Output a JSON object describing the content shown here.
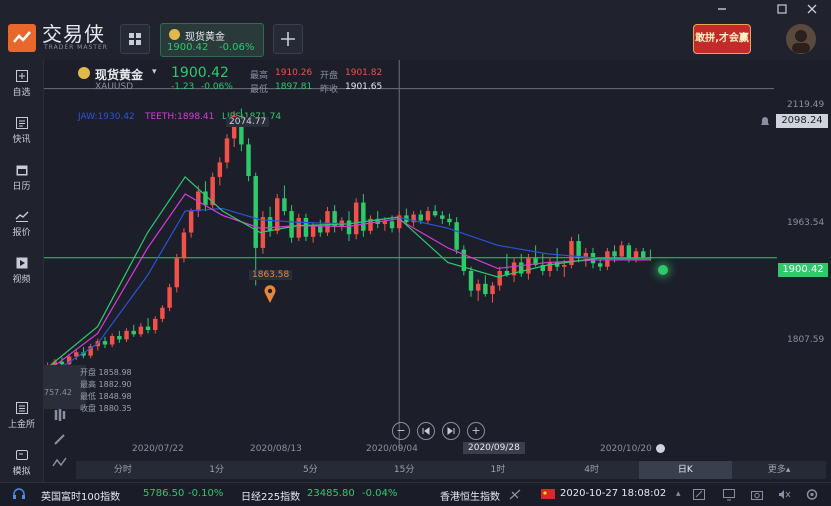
{
  "app": {
    "brand": "交易侠",
    "brand_sub": "TRADER MASTER",
    "promo": "敢拼,才会赢"
  },
  "tab": {
    "name": "现货黄金",
    "price": "1900.42",
    "change_pct": "-0.06%"
  },
  "window_controls": [
    "minimize-icon",
    "maximize-icon",
    "close-icon"
  ],
  "sidebar": {
    "top": [
      {
        "label": "自选",
        "icon": "watchlist-icon"
      },
      {
        "label": "快讯",
        "icon": "news-icon"
      },
      {
        "label": "日历",
        "icon": "calendar-icon"
      },
      {
        "label": "报价",
        "icon": "quote-icon"
      },
      {
        "label": "视频",
        "icon": "video-icon"
      }
    ],
    "bottom": [
      {
        "label": "上金所",
        "icon": "exchange-icon"
      },
      {
        "label": "模拟",
        "icon": "simulate-icon"
      }
    ]
  },
  "quote": {
    "name": "现货黄金",
    "code": "XAUUSD",
    "price": "1900.42",
    "change": "-1.23",
    "change_pct": "-0.06%",
    "high_label": "最高",
    "high": "1910.26",
    "open_label": "开盘",
    "open": "1901.82",
    "low_label": "最低",
    "low": "1897.81",
    "prev_label": "昨收",
    "prev": "1901.65"
  },
  "indicators": {
    "jaw": "JAW:1930.42",
    "teeth": "TEETH:1898.41",
    "lips": "LIPS:1871.74"
  },
  "ohlc_box": {
    "open": "开盘 1858.98",
    "high": "最高 1882.90",
    "low": "最低 1848.98",
    "close": "收盘 1880.35"
  },
  "colors": {
    "up": "#f0524a",
    "down": "#2fc86b",
    "jaw": "#2c52d6",
    "teeth": "#d63cd6",
    "lips": "#2fc86b",
    "current": "#2fc86b"
  },
  "chart_data": {
    "type": "candlestick",
    "ylim": [
      1740,
      2120
    ],
    "y_ticks": [
      "2119.49",
      "1963.54",
      "1807.59"
    ],
    "x_ticks": [
      "2020/07/22",
      "2020/08/13",
      "2020/09/04",
      "2020/09/28",
      "2020/10/20"
    ],
    "crosshair": {
      "date": "2020/09/28",
      "price": "2098.24"
    },
    "last_price": "1900.42",
    "markers": {
      "high": "2074.77",
      "low": "1863.58",
      "left_value": "757.42"
    },
    "candles": [
      [
        1768,
        1778,
        1764,
        1774
      ],
      [
        1774,
        1782,
        1770,
        1779
      ],
      [
        1779,
        1784,
        1774,
        1776
      ],
      [
        1776,
        1788,
        1772,
        1785
      ],
      [
        1785,
        1794,
        1781,
        1790
      ],
      [
        1790,
        1796,
        1783,
        1786
      ],
      [
        1786,
        1800,
        1783,
        1797
      ],
      [
        1797,
        1806,
        1792,
        1803
      ],
      [
        1803,
        1808,
        1795,
        1799
      ],
      [
        1799,
        1812,
        1796,
        1809
      ],
      [
        1809,
        1815,
        1801,
        1805
      ],
      [
        1805,
        1818,
        1802,
        1815
      ],
      [
        1815,
        1822,
        1808,
        1811
      ],
      [
        1811,
        1824,
        1808,
        1820
      ],
      [
        1820,
        1830,
        1812,
        1816
      ],
      [
        1816,
        1832,
        1812,
        1829
      ],
      [
        1829,
        1845,
        1825,
        1842
      ],
      [
        1842,
        1870,
        1838,
        1866
      ],
      [
        1866,
        1905,
        1860,
        1900
      ],
      [
        1900,
        1935,
        1895,
        1930
      ],
      [
        1930,
        1958,
        1924,
        1955
      ],
      [
        1955,
        1985,
        1948,
        1978
      ],
      [
        1978,
        1990,
        1955,
        1962
      ],
      [
        1962,
        2000,
        1958,
        1995
      ],
      [
        1995,
        2018,
        1985,
        2012
      ],
      [
        2012,
        2045,
        2005,
        2040
      ],
      [
        2040,
        2072,
        2030,
        2066
      ],
      [
        2066,
        2075,
        2025,
        2033
      ],
      [
        2033,
        2040,
        1990,
        1996
      ],
      [
        1996,
        2000,
        1868,
        1912
      ],
      [
        1912,
        1955,
        1905,
        1948
      ],
      [
        1948,
        1960,
        1925,
        1932
      ],
      [
        1932,
        1975,
        1928,
        1970
      ],
      [
        1970,
        1985,
        1950,
        1955
      ],
      [
        1955,
        1962,
        1918,
        1924
      ],
      [
        1924,
        1952,
        1920,
        1947
      ],
      [
        1947,
        1952,
        1920,
        1925
      ],
      [
        1925,
        1942,
        1918,
        1938
      ],
      [
        1938,
        1945,
        1925,
        1930
      ],
      [
        1930,
        1960,
        1926,
        1955
      ],
      [
        1955,
        1962,
        1930,
        1937
      ],
      [
        1937,
        1948,
        1932,
        1944
      ],
      [
        1944,
        1955,
        1920,
        1928
      ],
      [
        1928,
        1970,
        1922,
        1965
      ],
      [
        1965,
        1975,
        1925,
        1932
      ],
      [
        1932,
        1950,
        1928,
        1946
      ],
      [
        1946,
        1955,
        1935,
        1940
      ],
      [
        1940,
        1948,
        1932,
        1943
      ],
      [
        1943,
        1950,
        1930,
        1935
      ],
      [
        1935,
        1955,
        1930,
        1950
      ],
      [
        1950,
        1958,
        1938,
        1942
      ],
      [
        1942,
        1955,
        1937,
        1951
      ],
      [
        1951,
        1956,
        1940,
        1944
      ],
      [
        1944,
        1960,
        1940,
        1955
      ],
      [
        1955,
        1962,
        1948,
        1950
      ],
      [
        1950,
        1955,
        1940,
        1946
      ],
      [
        1946,
        1952,
        1938,
        1942
      ],
      [
        1942,
        1948,
        1905,
        1910
      ],
      [
        1910,
        1915,
        1880,
        1885
      ],
      [
        1885,
        1890,
        1855,
        1862
      ],
      [
        1862,
        1875,
        1850,
        1870
      ],
      [
        1870,
        1880,
        1855,
        1858
      ],
      [
        1858,
        1872,
        1848,
        1868
      ],
      [
        1868,
        1890,
        1862,
        1885
      ],
      [
        1885,
        1905,
        1878,
        1880
      ],
      [
        1880,
        1900,
        1872,
        1895
      ],
      [
        1895,
        1905,
        1878,
        1882
      ],
      [
        1882,
        1905,
        1875,
        1900
      ],
      [
        1900,
        1915,
        1890,
        1892
      ],
      [
        1892,
        1905,
        1880,
        1885
      ],
      [
        1885,
        1900,
        1878,
        1895
      ],
      [
        1895,
        1912,
        1885,
        1890
      ],
      [
        1890,
        1898,
        1878,
        1892
      ],
      [
        1892,
        1925,
        1888,
        1920
      ],
      [
        1920,
        1928,
        1895,
        1900
      ],
      [
        1900,
        1912,
        1890,
        1906
      ],
      [
        1906,
        1912,
        1888,
        1894
      ],
      [
        1894,
        1900,
        1885,
        1890
      ],
      [
        1890,
        1912,
        1886,
        1908
      ],
      [
        1908,
        1915,
        1895,
        1902
      ],
      [
        1902,
        1920,
        1898,
        1915
      ],
      [
        1915,
        1918,
        1895,
        1900
      ],
      [
        1900,
        1912,
        1895,
        1908
      ],
      [
        1908,
        1912,
        1898,
        1901
      ],
      [
        1901,
        1910,
        1897,
        1900
      ]
    ],
    "jaw": [
      [
        0,
        1762
      ],
      [
        20,
        1800
      ],
      [
        40,
        1880
      ],
      [
        55,
        1955
      ],
      [
        70,
        1958
      ],
      [
        85,
        1945
      ],
      [
        100,
        1942
      ],
      [
        120,
        1940
      ],
      [
        140,
        1948
      ],
      [
        160,
        1935
      ],
      [
        180,
        1915
      ],
      [
        200,
        1905
      ],
      [
        220,
        1900
      ],
      [
        241,
        1898
      ]
    ],
    "teeth": [
      [
        0,
        1768
      ],
      [
        20,
        1812
      ],
      [
        40,
        1912
      ],
      [
        55,
        1975
      ],
      [
        70,
        1950
      ],
      [
        85,
        1935
      ],
      [
        100,
        1938
      ],
      [
        120,
        1937
      ],
      [
        140,
        1946
      ],
      [
        160,
        1912
      ],
      [
        180,
        1888
      ],
      [
        200,
        1895
      ],
      [
        220,
        1898
      ],
      [
        241,
        1898
      ]
    ],
    "lips": [
      [
        0,
        1772
      ],
      [
        20,
        1820
      ],
      [
        40,
        1930
      ],
      [
        55,
        1995
      ],
      [
        70,
        1955
      ],
      [
        85,
        1930
      ],
      [
        100,
        1938
      ],
      [
        120,
        1940
      ],
      [
        140,
        1948
      ],
      [
        160,
        1895
      ],
      [
        180,
        1878
      ],
      [
        200,
        1892
      ],
      [
        220,
        1900
      ],
      [
        241,
        1900
      ]
    ]
  },
  "timeframes": [
    "分时",
    "1分",
    "5分",
    "15分",
    "1时",
    "4时",
    "日K",
    "更多▴"
  ],
  "active_timeframe": "日K",
  "status": [
    {
      "name": "英国富时100指数",
      "value": "5786.50",
      "pct": "-0.10%"
    },
    {
      "name": "日经225指数",
      "value": "23485.80",
      "pct": "-0.04%"
    },
    {
      "name": "香港恒生指数",
      "value": "",
      "pct": ""
    }
  ],
  "clock": "2020-10-27 18:08:02"
}
